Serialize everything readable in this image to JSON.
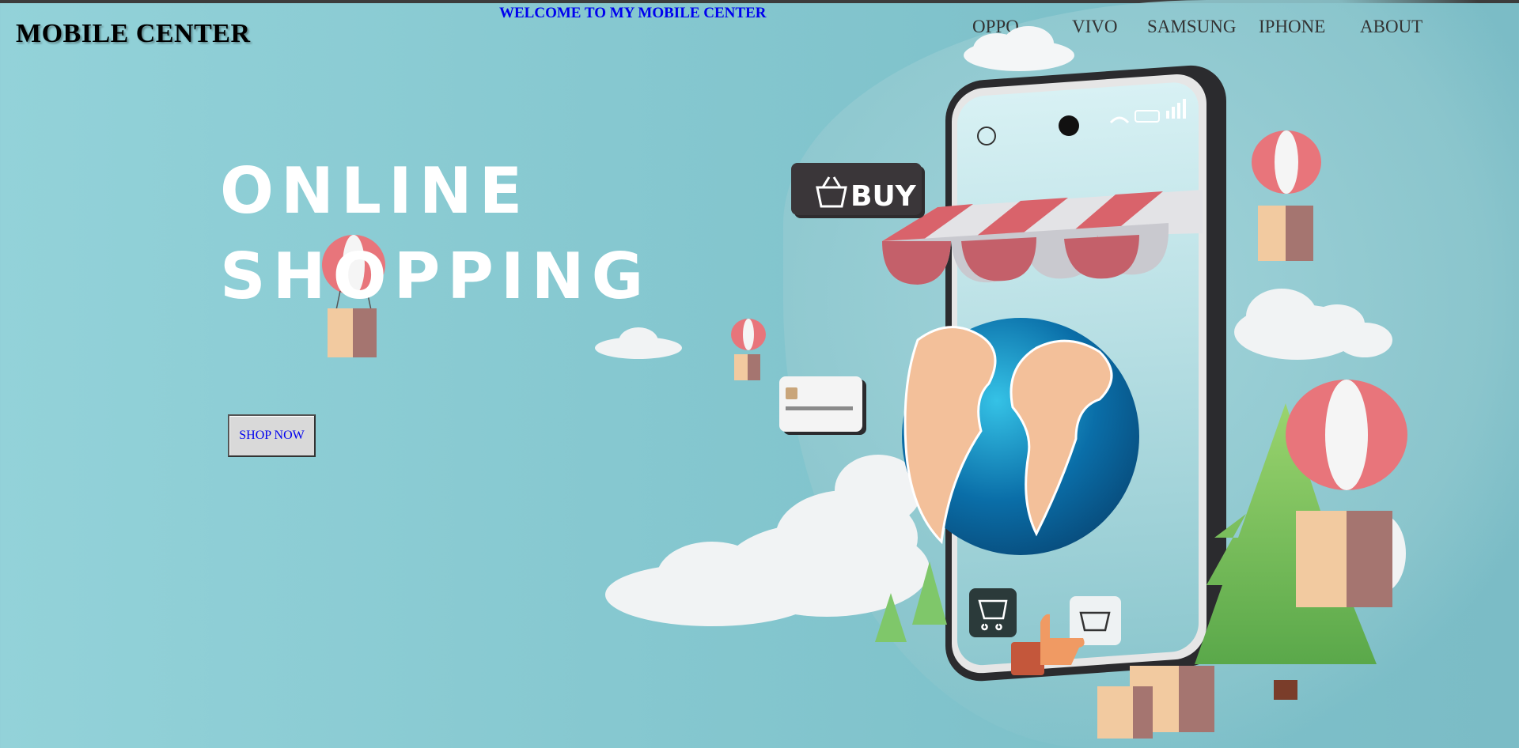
{
  "header": {
    "logo": "MOBILE CENTER",
    "welcome": "WELCOME TO MY MOBILE CENTER"
  },
  "nav": {
    "items": [
      {
        "label": "OPPO"
      },
      {
        "label": "VIVO"
      },
      {
        "label": "SAMSUNG"
      },
      {
        "label": "IPHONE"
      },
      {
        "label": "ABOUT"
      }
    ]
  },
  "hero": {
    "line1": "ONLINE",
    "line2": "SHOPPING",
    "cta_label": "SHOP NOW",
    "buy_sign": "BUY"
  },
  "colors": {
    "link": "#0000ee",
    "background": "#86c8d0",
    "awning_red": "#d9636b",
    "balloon_red": "#e8757b"
  },
  "icons": [
    "clock-icon",
    "wifi-icon",
    "battery-icon",
    "signal-icon",
    "cart-icon",
    "basket-icon",
    "thumbs-up-icon",
    "credit-card-icon",
    "globe-icon"
  ]
}
